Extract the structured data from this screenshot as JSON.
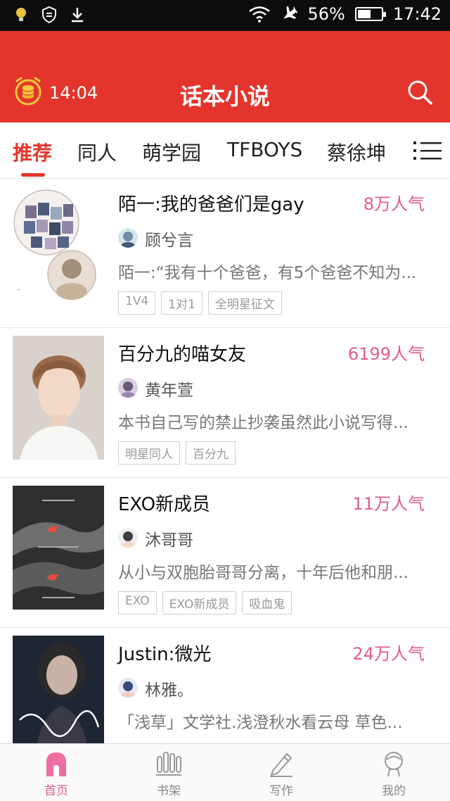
{
  "statusbar": {
    "battery": "56%",
    "time": "17:42"
  },
  "header": {
    "timer": "14:04",
    "title": "话本小说"
  },
  "tabs": [
    {
      "label": "推荐",
      "active": true
    },
    {
      "label": "同人",
      "active": false
    },
    {
      "label": "萌学园",
      "active": false
    },
    {
      "label": "TFBOYS",
      "active": false
    },
    {
      "label": "蔡徐坤",
      "active": false
    }
  ],
  "books": [
    {
      "title": "陌一:我的爸爸们是gay",
      "popularity": "8万人气",
      "author": "顾兮言",
      "description": "陌一:“我有十个爸爸，有5个爸爸不知为...",
      "tags": [
        "1V4",
        "1对1",
        "全明星征文"
      ]
    },
    {
      "title": "百分九的喵女友",
      "popularity": "6199人气",
      "author": "黄年萱",
      "description": "本书自己写的禁止抄袭虽然此小说写得...",
      "tags": [
        "明星同人",
        "百分九"
      ]
    },
    {
      "title": "EXO新成员",
      "popularity": "11万人气",
      "author": "沐哥哥",
      "description": "从小与双胞胎哥哥分离，十年后他和朋...",
      "tags": [
        "EXO",
        "EXO新成员",
        "吸血鬼"
      ]
    },
    {
      "title": "Justin:微光",
      "popularity": "24万人气",
      "author": "林雅。",
      "description": "「浅草」文学社.浅澄秋水看云母 草色...",
      "tags": []
    }
  ],
  "bottom_nav": [
    {
      "label": "首页",
      "icon": "home-icon",
      "active": true
    },
    {
      "label": "书架",
      "icon": "bookshelf-icon",
      "active": false
    },
    {
      "label": "写作",
      "icon": "pencil-icon",
      "active": false
    },
    {
      "label": "我的",
      "icon": "profile-icon",
      "active": false
    }
  ],
  "colors": {
    "accent": "#e4352c",
    "popularity": "#e25c8a"
  }
}
